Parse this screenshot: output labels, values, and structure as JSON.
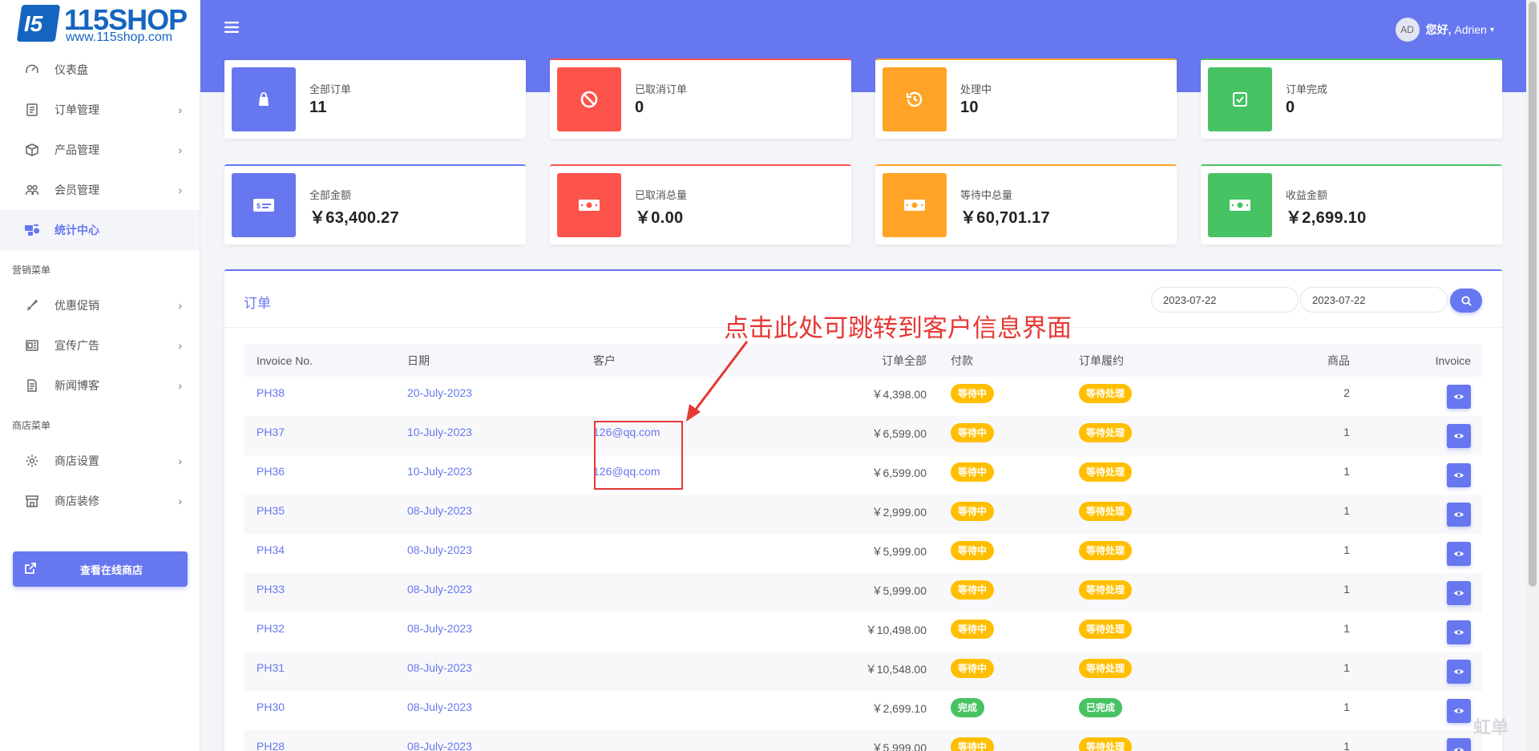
{
  "brand": {
    "logo_mark": "I5",
    "name": "115SHOP",
    "url": "www.115shop.com"
  },
  "colors": {
    "primary": "#6777ef",
    "danger": "#fc544b",
    "warning": "#ffa426",
    "success": "#47c363",
    "badge_warning": "#ffbf00"
  },
  "sidebar": {
    "items": [
      {
        "label": "仪表盘",
        "icon": "gauge-icon",
        "chevron": false
      },
      {
        "label": "订单管理",
        "icon": "order-list-icon",
        "chevron": true
      },
      {
        "label": "产品管理",
        "icon": "box-icon",
        "chevron": true
      },
      {
        "label": "会员管理",
        "icon": "users-icon",
        "chevron": true
      },
      {
        "label": "统计中心",
        "icon": "stats-icon",
        "chevron": false,
        "active": true
      }
    ],
    "section_marketing": "营销菜单",
    "marketing_items": [
      {
        "label": "优惠促销",
        "icon": "tag-icon",
        "chevron": true
      },
      {
        "label": "宣传广告",
        "icon": "ad-icon",
        "chevron": true
      },
      {
        "label": "新闻博客",
        "icon": "blog-icon",
        "chevron": true
      }
    ],
    "section_store": "商店菜单",
    "store_items": [
      {
        "label": "商店设置",
        "icon": "gear-icon",
        "chevron": true
      },
      {
        "label": "商店装修",
        "icon": "storefront-icon",
        "chevron": true
      }
    ],
    "chevron": "›",
    "view_store_label": "查看在线商店"
  },
  "header": {
    "avatar": "AD",
    "greeting": "您好,",
    "user": "Adrien",
    "caret": "▾"
  },
  "stats_top": [
    {
      "label": "全部订单",
      "value": "11",
      "color": "#6777ef",
      "icon": "shopping-bag-icon"
    },
    {
      "label": "已取消订单",
      "value": "0",
      "color": "#fc544b",
      "icon": "ban-icon"
    },
    {
      "label": "处理中",
      "value": "10",
      "color": "#ffa426",
      "icon": "history-icon"
    },
    {
      "label": "订单完成",
      "value": "0",
      "color": "#47c363",
      "icon": "check-square-icon"
    }
  ],
  "stats_bottom": [
    {
      "label": "全部金额",
      "value": "￥63,400.27",
      "color": "#6777ef",
      "icon": "credit-card-icon"
    },
    {
      "label": "已取消总量",
      "value": "￥0.00",
      "color": "#fc544b",
      "icon": "money-bill-icon"
    },
    {
      "label": "等待中总量",
      "value": "￥60,701.17",
      "color": "#ffa426",
      "icon": "money-bill-icon"
    },
    {
      "label": "收益金额",
      "value": "￥2,699.10",
      "color": "#47c363",
      "icon": "money-bill-icon"
    }
  ],
  "orders": {
    "title": "订单",
    "date_from": "2023-07-22",
    "date_to": "2023-07-22",
    "columns": [
      "Invoice No.",
      "日期",
      "客户",
      "订单全部",
      "付款",
      "订单履约",
      "商品",
      "Invoice"
    ],
    "rows": [
      {
        "invoice": "PH38",
        "date": "20-July-2023",
        "customer": "",
        "total": "￥4,398.00",
        "payment": "等待中",
        "payment_status": "warn",
        "fulfillment": "等待处理",
        "fulfillment_status": "warn",
        "items": "2"
      },
      {
        "invoice": "PH37",
        "date": "10-July-2023",
        "customer": "126@qq.com",
        "total": "￥6,599.00",
        "payment": "等待中",
        "payment_status": "warn",
        "fulfillment": "等待处理",
        "fulfillment_status": "warn",
        "items": "1"
      },
      {
        "invoice": "PH36",
        "date": "10-July-2023",
        "customer": "126@qq.com",
        "total": "￥6,599.00",
        "payment": "等待中",
        "payment_status": "warn",
        "fulfillment": "等待处理",
        "fulfillment_status": "warn",
        "items": "1"
      },
      {
        "invoice": "PH35",
        "date": "08-July-2023",
        "customer": "",
        "total": "￥2,999.00",
        "payment": "等待中",
        "payment_status": "warn",
        "fulfillment": "等待处理",
        "fulfillment_status": "warn",
        "items": "1"
      },
      {
        "invoice": "PH34",
        "date": "08-July-2023",
        "customer": "",
        "total": "￥5,999.00",
        "payment": "等待中",
        "payment_status": "warn",
        "fulfillment": "等待处理",
        "fulfillment_status": "warn",
        "items": "1"
      },
      {
        "invoice": "PH33",
        "date": "08-July-2023",
        "customer": "",
        "total": "￥5,999.00",
        "payment": "等待中",
        "payment_status": "warn",
        "fulfillment": "等待处理",
        "fulfillment_status": "warn",
        "items": "1"
      },
      {
        "invoice": "PH32",
        "date": "08-July-2023",
        "customer": "",
        "total": "￥10,498.00",
        "payment": "等待中",
        "payment_status": "warn",
        "fulfillment": "等待处理",
        "fulfillment_status": "warn",
        "items": "1"
      },
      {
        "invoice": "PH31",
        "date": "08-July-2023",
        "customer": "",
        "total": "￥10,548.00",
        "payment": "等待中",
        "payment_status": "warn",
        "fulfillment": "等待处理",
        "fulfillment_status": "warn",
        "items": "1"
      },
      {
        "invoice": "PH30",
        "date": "08-July-2023",
        "customer": "",
        "total": "￥2,699.10",
        "payment": "完成",
        "payment_status": "ok",
        "fulfillment": "已完成",
        "fulfillment_status": "ok",
        "items": "1"
      },
      {
        "invoice": "PH28",
        "date": "08-July-2023",
        "customer": "",
        "total": "￥5,999.00",
        "payment": "等待中",
        "payment_status": "warn",
        "fulfillment": "等待处理",
        "fulfillment_status": "warn",
        "items": "1"
      }
    ]
  },
  "annotation": {
    "text": "点击此处可跳转到客户信息界面"
  },
  "watermark": "虹单"
}
